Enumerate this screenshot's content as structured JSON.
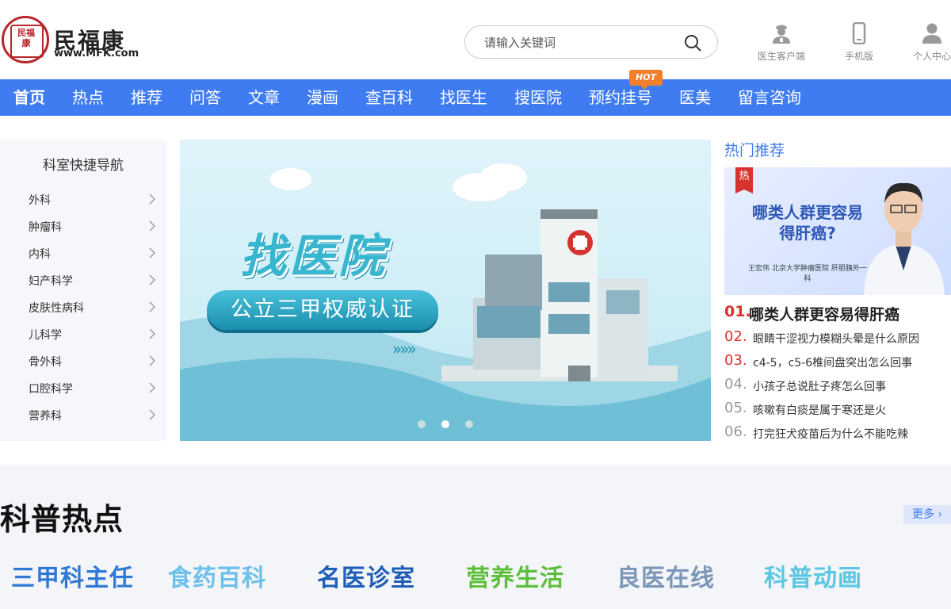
{
  "header": {
    "logo_name": "民福康",
    "logo_url": "www.MFK.com",
    "logo_seal": "民福康",
    "search_placeholder": "请输入关键词",
    "links": [
      {
        "label": "医生客户端",
        "icon": "doctor-icon"
      },
      {
        "label": "手机版",
        "icon": "phone-icon"
      },
      {
        "label": "个人中心",
        "icon": "user-icon"
      }
    ]
  },
  "nav": {
    "items": [
      "首页",
      "热点",
      "推荐",
      "问答",
      "文章",
      "漫画",
      "查百科",
      "找医生",
      "搜医院",
      "预约挂号",
      "医美",
      "留言咨询"
    ],
    "hot_badge": "HOT"
  },
  "sidebar": {
    "title": "科室快捷导航",
    "items": [
      "外科",
      "肿瘤科",
      "内科",
      "妇产科学",
      "皮肤性病科",
      "儿科学",
      "骨外科",
      "口腔科学",
      "营养科"
    ]
  },
  "banner": {
    "title": "找医院",
    "pill": "公立三甲权威认证",
    "arrows": "»»»",
    "active_slide": 2,
    "slide_count": 3
  },
  "hot": {
    "title": "热门推荐",
    "card_tag": "热",
    "card_text": "哪类人群更容易得肝癌?",
    "card_sub": "王宏伟 北京大学肿瘤医院 肝胆胰外一科",
    "items": [
      {
        "num": "01.",
        "text": "哪类人群更容易得肝癌"
      },
      {
        "num": "02.",
        "text": "眼睛干涩视力模糊头晕是什么原因"
      },
      {
        "num": "03.",
        "text": "c4-5，c5-6椎间盘突出怎么回事"
      },
      {
        "num": "04.",
        "text": "小孩子总说肚子疼怎么回事"
      },
      {
        "num": "05.",
        "text": "咳嗽有白痰是属于寒还是火"
      },
      {
        "num": "06.",
        "text": "打完狂犬疫苗后为什么不能吃辣"
      }
    ]
  },
  "section": {
    "title": "科普热点",
    "more": "更多",
    "brands": [
      {
        "text": "三甲科主任",
        "color": "#2f78d6"
      },
      {
        "text": "食药百科",
        "color": "#6cc0ea"
      },
      {
        "text": "名医诊室",
        "color": "#1f5fb8"
      },
      {
        "text": "营养生活",
        "color": "#5cbf3a"
      },
      {
        "text": "良医在线",
        "color": "#7a97b8"
      },
      {
        "text": "科普动画",
        "color": "#5bc6e2"
      }
    ]
  },
  "colors": {
    "accent": "#3f7cf1",
    "hot_red": "#d6332f",
    "hot_orange": "#f07f2e"
  }
}
